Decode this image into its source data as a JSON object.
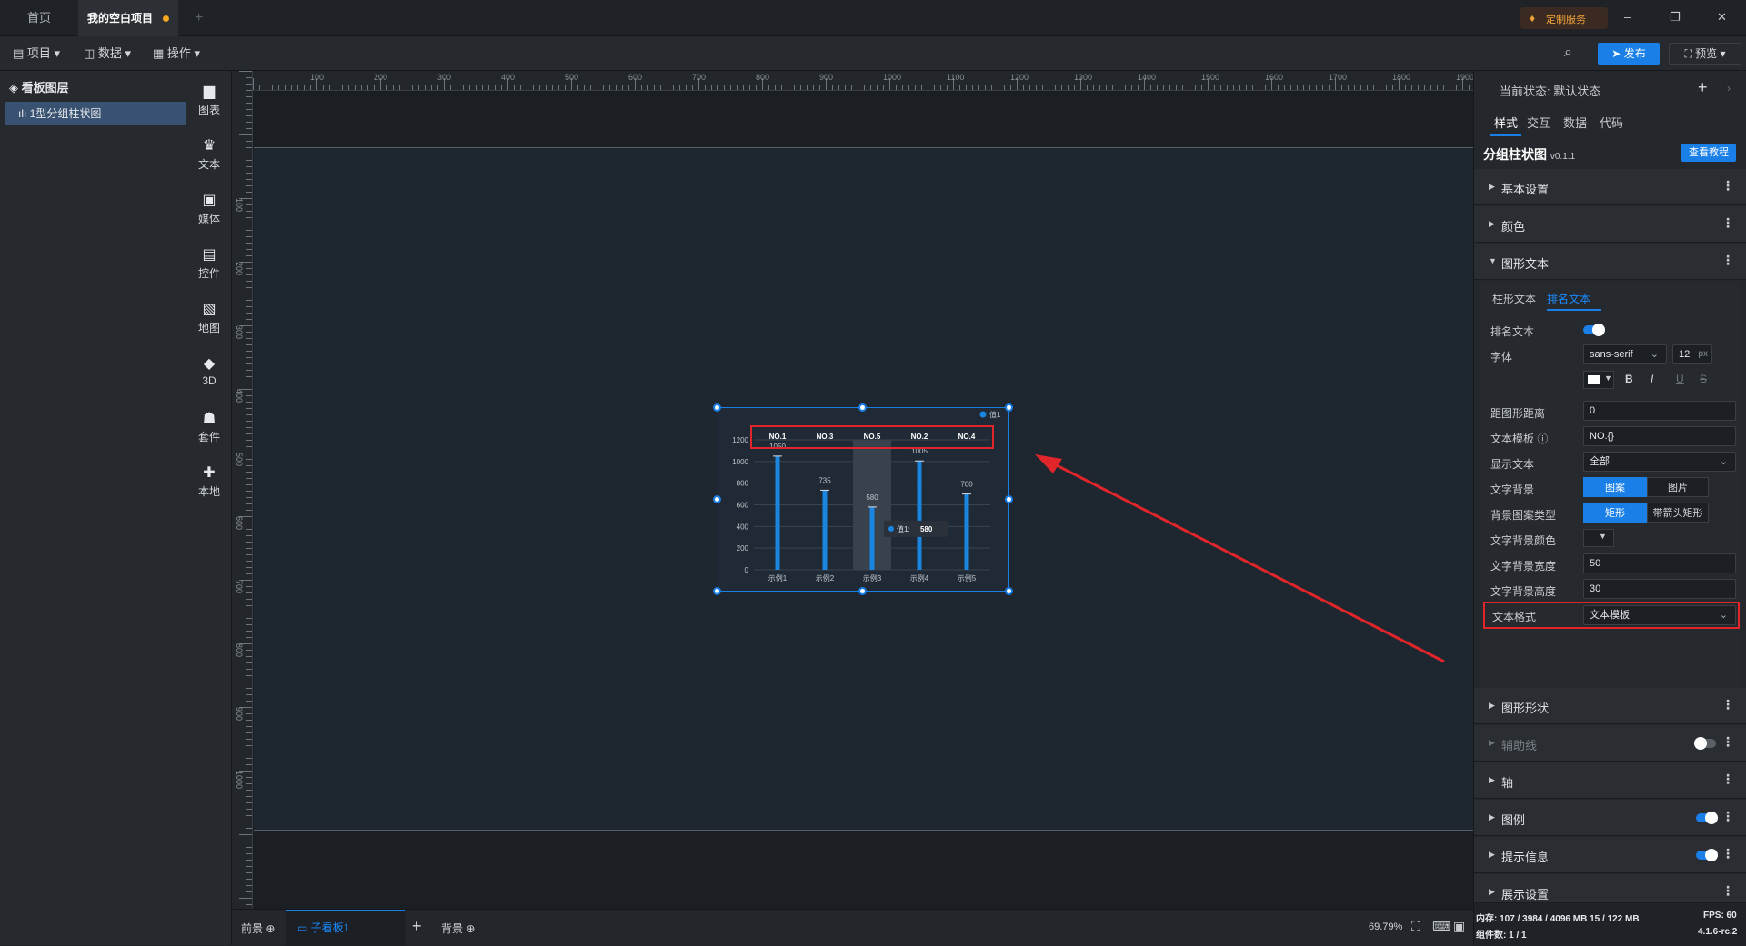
{
  "tabs": {
    "home": "首页",
    "project": "我的空白项目",
    "add": "+"
  },
  "window": {
    "custom_service": "定制服务",
    "minimize": "–",
    "restore": "❐",
    "close": "✕"
  },
  "menubar": {
    "project": "项目",
    "data": "数据",
    "operate": "操作",
    "publish": "发布",
    "preview": "预览"
  },
  "layers": {
    "title": "看板图层",
    "items": [
      {
        "label": "1型分组柱状图"
      }
    ]
  },
  "toolbox": [
    {
      "label": "图表",
      "icon": "bar-chart-icon"
    },
    {
      "label": "文本",
      "icon": "text-icon"
    },
    {
      "label": "媒体",
      "icon": "media-icon"
    },
    {
      "label": "控件",
      "icon": "widget-icon"
    },
    {
      "label": "地图",
      "icon": "map-icon"
    },
    {
      "label": "3D",
      "icon": "cube-icon"
    },
    {
      "label": "套件",
      "icon": "kit-icon"
    },
    {
      "label": "本地",
      "icon": "puzzle-icon"
    }
  ],
  "ruler": {
    "top": [
      "100",
      "200",
      "300",
      "400",
      "500",
      "600",
      "700",
      "800",
      "900",
      "1000",
      "1100",
      "1200",
      "1300",
      "1400",
      "1500",
      "1600",
      "1700",
      "1800",
      "1900"
    ],
    "left": [
      "100",
      "200",
      "300",
      "400",
      "500",
      "600",
      "700",
      "800",
      "900",
      "1000"
    ]
  },
  "chart_data": {
    "type": "bar",
    "categories": [
      "示例1",
      "示例2",
      "示例3",
      "示例4",
      "示例5"
    ],
    "series": [
      {
        "name": "值1",
        "values": [
          1050,
          735,
          580,
          1005,
          700
        ]
      }
    ],
    "rank_labels": [
      "NO.1",
      "NO.3",
      "NO.5",
      "NO.2",
      "NO.4"
    ],
    "value_labels": [
      "1050",
      "735",
      "580",
      "1005",
      "700"
    ],
    "yticks": [
      "0",
      "200",
      "400",
      "600",
      "800",
      "1000",
      "1200"
    ],
    "ylim": [
      0,
      1200
    ],
    "legend": "top-right",
    "tooltip": {
      "series": "值1:",
      "value": "580"
    },
    "highlighted_category": "示例3",
    "bar_color": "#1a86e0"
  },
  "bottombar": {
    "foreground": "前景",
    "subboard": "子看板1",
    "add": "+",
    "background": "背景",
    "zoom": "69.79%"
  },
  "status": {
    "memory": "内存: 107 / 3984 / 4096 MB 15 / 122 MB",
    "fps": "FPS: 60",
    "components": "组件数: 1 / 1",
    "version": "4.1.6-rc.2"
  },
  "panel": {
    "state_label": "当前状态:",
    "state_value": "默认状态",
    "tabs": [
      "样式",
      "交互",
      "数据",
      "代码"
    ],
    "component_name": "分组柱状图",
    "component_version": "v0.1.1",
    "tutorial": "查看教程",
    "sections": {
      "basic": "基本设置",
      "color": "颜色",
      "shape_text": "图形文本",
      "shape": "图形形状",
      "guide": "辅助线",
      "axis": "轴",
      "legend": "图例",
      "tooltip": "提示信息",
      "display": "展示设置"
    },
    "subtabs": [
      "柱形文本",
      "排名文本"
    ],
    "fields": {
      "rank_text": "排名文本",
      "font": "字体",
      "font_value": "sans-serif",
      "font_size": "12",
      "font_unit": "px",
      "bold": "B",
      "italic": "I",
      "underline": "U",
      "strike": "S",
      "distance": "距图形距离",
      "distance_value": "0",
      "template": "文本模板",
      "template_value": "NO.{}",
      "show_text": "显示文本",
      "show_text_value": "全部",
      "text_bg": "文字背景",
      "bg_pattern": "图案",
      "bg_image": "图片",
      "bg_pattern_type": "背景图案类型",
      "rect": "矩形",
      "arrow_rect": "带箭头矩形",
      "bg_color": "文字背景颜色",
      "bg_width": "文字背景宽度",
      "bg_width_value": "50",
      "bg_height": "文字背景高度",
      "bg_height_value": "30",
      "text_format": "文本格式",
      "text_format_value": "文本模板"
    }
  },
  "colors": {
    "accent": "#1a7fe6",
    "highlight_box": "#e0262b",
    "arrow": "#e0262b"
  }
}
